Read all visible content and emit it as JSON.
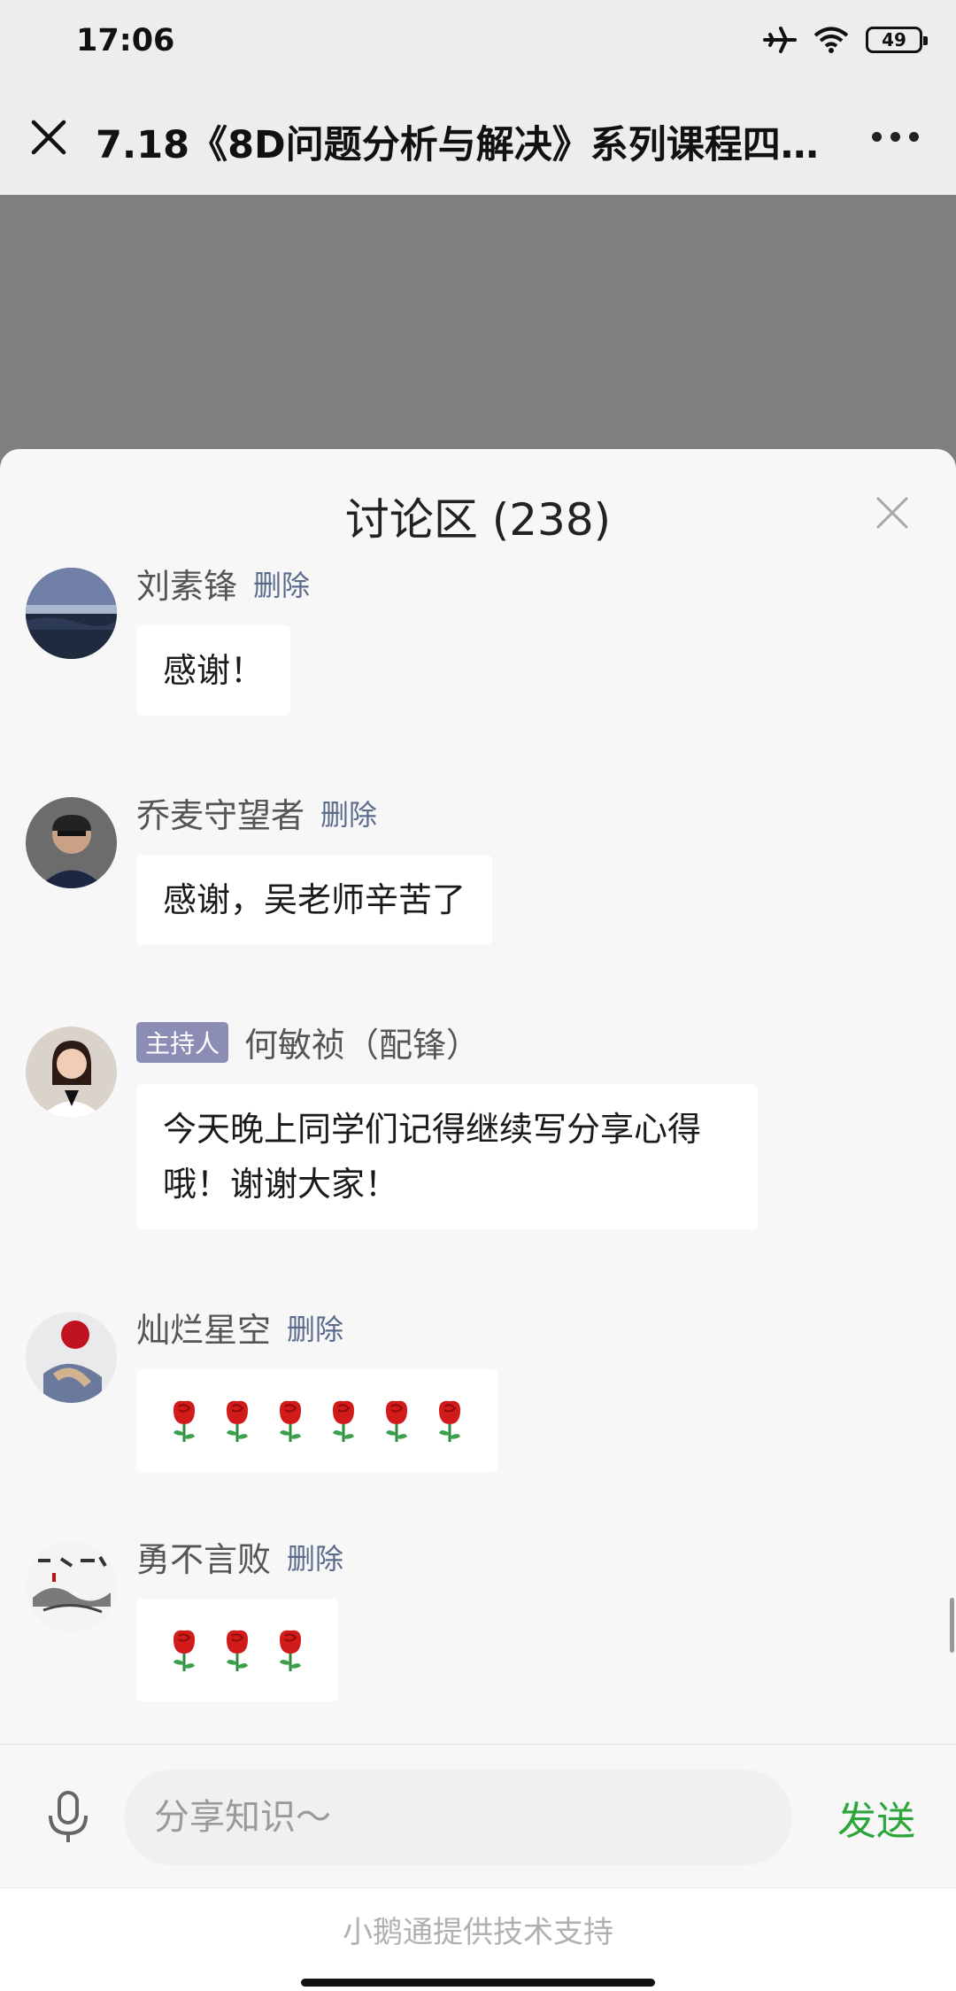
{
  "status_bar": {
    "time": "17:06",
    "battery_level": "49",
    "icons": [
      "airplane-icon",
      "wifi-icon",
      "battery-icon"
    ]
  },
  "nav": {
    "title": "7.18《8D问题分析与解决》系列课程四《…",
    "icons": [
      "close-icon",
      "more-icon"
    ]
  },
  "panel": {
    "title": "讨论区 (238)"
  },
  "messages": [
    {
      "username": "刘素锋",
      "action": "删除",
      "text": "感谢！"
    },
    {
      "username": "乔麦守望者",
      "action": "删除",
      "text": "感谢，吴老师辛苦了"
    },
    {
      "badge": "主持人",
      "username": "何敏祯（配锋）",
      "text_lines": [
        "今天晚上同学们记得继续写分享心得",
        "哦！谢谢大家！"
      ]
    },
    {
      "username": "灿烂星空",
      "action": "删除",
      "emoji": "rose-icon",
      "emoji_count": 6
    },
    {
      "username": "勇不言败",
      "action": "删除",
      "emoji": "rose-icon",
      "emoji_count": 3
    }
  ],
  "input": {
    "placeholder": "分享知识～",
    "send_label": "发送"
  },
  "footer": {
    "text": "小鹅通提供技术支持"
  },
  "colors": {
    "accent_green": "#2ca53a",
    "link_blue": "#5b6b8c",
    "host_badge": "#8c8db5"
  }
}
